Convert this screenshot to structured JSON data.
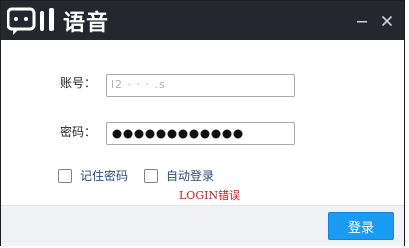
{
  "window": {
    "app_name": "语音",
    "minimize_icon": "minimize-icon",
    "close_icon": "close-icon"
  },
  "form": {
    "account_label": "账号：",
    "account_value": "l2 · · · .s",
    "password_label": "密码：",
    "password_dot_count": 12,
    "remember_password_label": "记住密码",
    "auto_login_label": "自动登录",
    "error_message": "LOGIN错误"
  },
  "footer": {
    "login_button_label": "登录"
  },
  "colors": {
    "titlebar": "#24282e",
    "accent": "#1b9cf2",
    "error": "#d11b1b",
    "link": "#2a4a7c",
    "footer_bg": "#f0f2f5"
  }
}
